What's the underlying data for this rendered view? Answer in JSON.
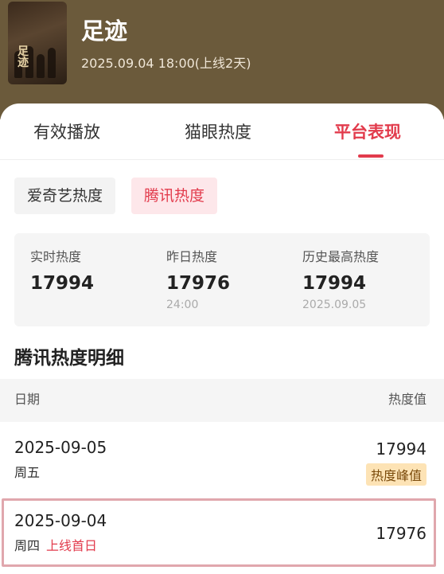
{
  "header": {
    "title": "足迹",
    "subtitle": "2025.09.04 18:00(上线2天)",
    "poster_text": "足迹"
  },
  "tabs": [
    {
      "label": "有效播放",
      "active": false
    },
    {
      "label": "猫眼热度",
      "active": false
    },
    {
      "label": "平台表现",
      "active": true
    }
  ],
  "platforms": [
    {
      "label": "爱奇艺热度",
      "selected": false
    },
    {
      "label": "腾讯热度",
      "selected": true
    }
  ],
  "stats": {
    "realtime": {
      "label": "实时热度",
      "value": "17994"
    },
    "yesterday": {
      "label": "昨日热度",
      "value": "17976",
      "sub": "24:00"
    },
    "history_max": {
      "label": "历史最高热度",
      "value": "17994",
      "sub": "2025.09.05"
    }
  },
  "detail": {
    "title": "腾讯热度明细",
    "col_date": "日期",
    "col_value": "热度值",
    "rows": [
      {
        "date": "2025-09-05",
        "weekday": "周五",
        "value": "17994",
        "badge": "热度峰值"
      },
      {
        "date": "2025-09-04",
        "weekday": "周四",
        "tag": "上线首日",
        "value": "17976"
      }
    ]
  },
  "colors": {
    "accent": "#e23b4c",
    "header_bg": "#6b5a3b",
    "peak_badge_bg": "#fde3b5",
    "highlight_border": "#e0a7ad"
  }
}
